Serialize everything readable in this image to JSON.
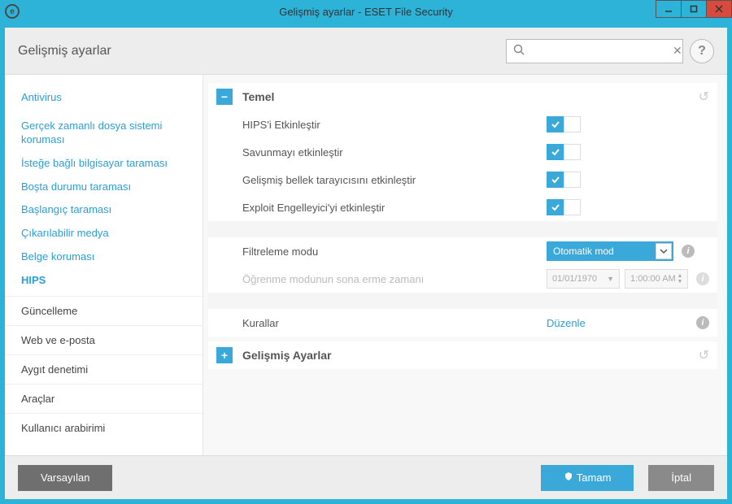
{
  "window": {
    "title": "Gelişmiş ayarlar - ESET File Security"
  },
  "header": {
    "title": "Gelişmiş ayarlar",
    "search_placeholder": ""
  },
  "sidebar": {
    "sub": [
      "Antivirus",
      "Gerçek zamanlı dosya sistemi koruması",
      "İsteğe bağlı bilgisayar taraması",
      "Boşta durumu taraması",
      "Başlangıç taraması",
      "Çıkarılabilir medya",
      "Belge koruması",
      "HIPS"
    ],
    "main": [
      "Güncelleme",
      "Web ve e-posta",
      "Aygıt denetimi",
      "Araçlar",
      "Kullanıcı arabirimi"
    ]
  },
  "sections": {
    "basic": {
      "title": "Temel",
      "rows": {
        "hips_enable": "HIPS'i Etkinleştir",
        "self_defense": "Savunmayı etkinleştir",
        "adv_mem": "Gelişmiş bellek tarayıcısını etkinleştir",
        "exploit": "Exploit Engelleyici'yi etkinleştir",
        "filter_mode": "Filtreleme modu",
        "filter_mode_value": "Otomatik mod",
        "learn_expire": "Öğrenme modunun sona erme zamanı",
        "learn_date": "01/01/1970",
        "learn_time": "1:00:00 AM",
        "rules": "Kurallar",
        "rules_edit": "Düzenle"
      }
    },
    "advanced": {
      "title": "Gelişmiş Ayarlar"
    }
  },
  "footer": {
    "default": "Varsayılan",
    "ok": "Tamam",
    "cancel": "İptal"
  }
}
